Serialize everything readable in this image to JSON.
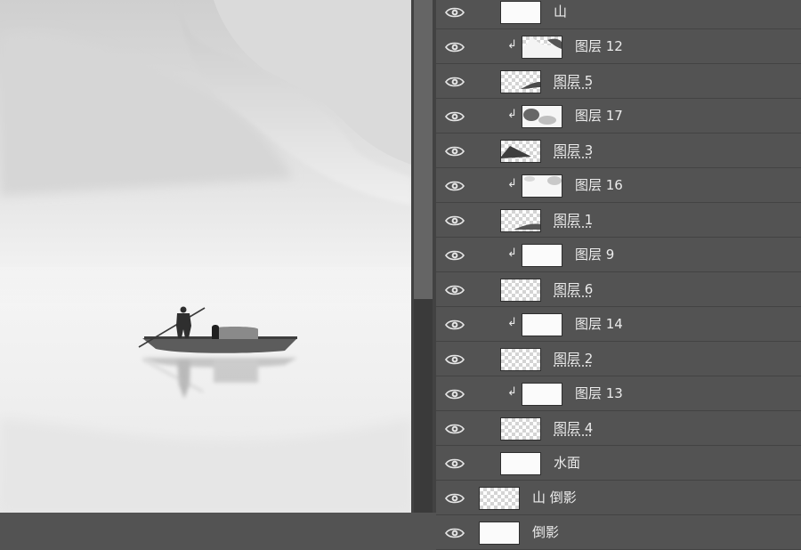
{
  "layers": [
    {
      "name": "山",
      "type": "group",
      "thumb": "solid"
    },
    {
      "name": "图层 12",
      "clip": true,
      "thumb": "mist-right",
      "linked": false
    },
    {
      "name": "图层 5",
      "clip": false,
      "thumb": "ridge",
      "linked": true
    },
    {
      "name": "图层 17",
      "clip": true,
      "thumb": "mist-left",
      "linked": false
    },
    {
      "name": "图层 3",
      "clip": false,
      "thumb": "mountain",
      "linked": true
    },
    {
      "name": "图层 16",
      "clip": true,
      "thumb": "mist-soft",
      "linked": false
    },
    {
      "name": "图层 1",
      "clip": false,
      "thumb": "ridge-low",
      "linked": true
    },
    {
      "name": "图层 9",
      "clip": true,
      "thumb": "solid",
      "linked": false
    },
    {
      "name": "图层 6",
      "clip": false,
      "thumb": "checker",
      "linked": true
    },
    {
      "name": "图层 14",
      "clip": true,
      "thumb": "solid",
      "linked": false
    },
    {
      "name": "图层 2",
      "clip": false,
      "thumb": "checker",
      "linked": true
    },
    {
      "name": "图层 13",
      "clip": true,
      "thumb": "solid",
      "linked": false
    },
    {
      "name": "图层 4",
      "clip": false,
      "thumb": "checker",
      "linked": true
    },
    {
      "name": "水面",
      "clip": false,
      "thumb": "solid",
      "linked": false
    },
    {
      "name": "山 倒影",
      "clip": false,
      "thumb": "checker-wide",
      "linked": false
    },
    {
      "name": "倒影",
      "clip": false,
      "thumb": "solid",
      "linked": false
    }
  ],
  "icons": {
    "visibility": "eye-icon",
    "clip": "clipping-arrow-icon"
  },
  "colors": {
    "panel": "#535353",
    "divider": "#434343",
    "text": "#ececec"
  }
}
